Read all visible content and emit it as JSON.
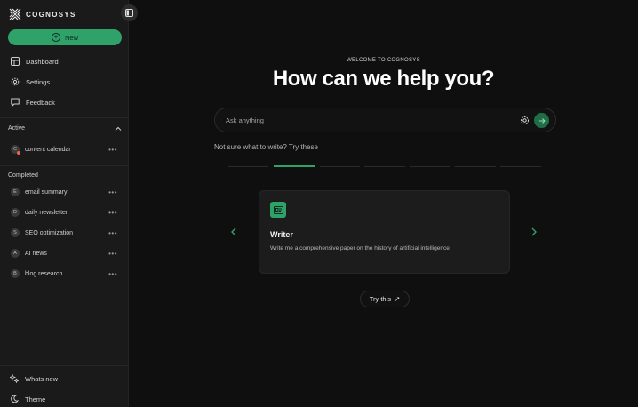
{
  "brand": {
    "name": "COGNOSYS"
  },
  "sidebar": {
    "new_label": "New",
    "nav": [
      {
        "label": "Dashboard",
        "icon": "dashboard-icon"
      },
      {
        "label": "Settings",
        "icon": "gear-icon"
      },
      {
        "label": "Feedback",
        "icon": "feedback-icon"
      }
    ],
    "active_title": "Active",
    "active": [
      {
        "initial": "C",
        "label": "content calendar"
      }
    ],
    "completed_title": "Completed",
    "completed": [
      {
        "initial": "E",
        "label": "email summary"
      },
      {
        "initial": "D",
        "label": "daily newsletter"
      },
      {
        "initial": "S",
        "label": "SEO optimization"
      },
      {
        "initial": "A",
        "label": "AI news"
      },
      {
        "initial": "B",
        "label": "blog research"
      }
    ],
    "more_glyph": "•••",
    "bottom": [
      {
        "label": "Whats new",
        "icon": "sparkle-icon"
      },
      {
        "label": "Theme",
        "icon": "moon-icon"
      }
    ]
  },
  "main": {
    "eyebrow": "WELCOME TO COGNOSYS",
    "headline": "How can we help you?",
    "search_placeholder": "Ask anything",
    "hint": "Not sure what to write? Try these",
    "active_tab_index": 1,
    "card": {
      "title": "Writer",
      "description": "Write me a comprehensive paper on the history of artificial intelligence"
    },
    "try_label": "Try this",
    "try_arrow": "↗"
  },
  "colors": {
    "accent": "#2fa26a",
    "background": "#0f0f0f",
    "sidebar": "#1a1a1a"
  }
}
